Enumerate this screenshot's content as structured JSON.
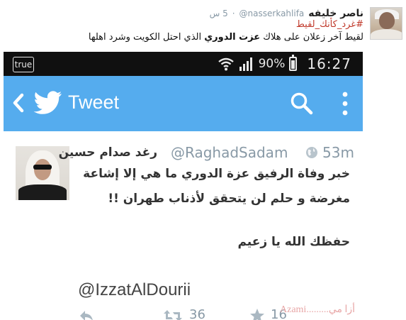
{
  "post": {
    "author_name": "ناصر خليفه",
    "author_handle": "@nasserkahlifa",
    "time": "5 س",
    "hashtag": "#غرد_كأنك_لقيط",
    "body_before": "لقيط آخر زعلان على هلاك ",
    "body_bold": "عزت الدوري",
    "body_after": " الذي احتل الكويت وشرد اهلها"
  },
  "phone": {
    "status": {
      "carrier": "true",
      "battery": "90%",
      "clock": "16:27"
    },
    "appbar": {
      "title": "Tweet"
    },
    "tweet": {
      "name": "رغد صدام حسين",
      "handle": "@RaghadSadam",
      "time": "53m",
      "line1": "خبر وفاة الرفيق عزة الدوري ما هي إلا إشاعة",
      "line2": "مغرضة و حلم لن يتحقق لأذناب طهران !!",
      "line3": "حفظك الله يا زعيم",
      "mention": "@IzzatAlDourii",
      "retweets": "36",
      "favorites": "16"
    }
  },
  "watermark": "Azami.........أزا مي",
  "colors": {
    "twitter_blue": "#55acee",
    "hashtag_red": "#c0392b",
    "status_bg": "#101010"
  }
}
